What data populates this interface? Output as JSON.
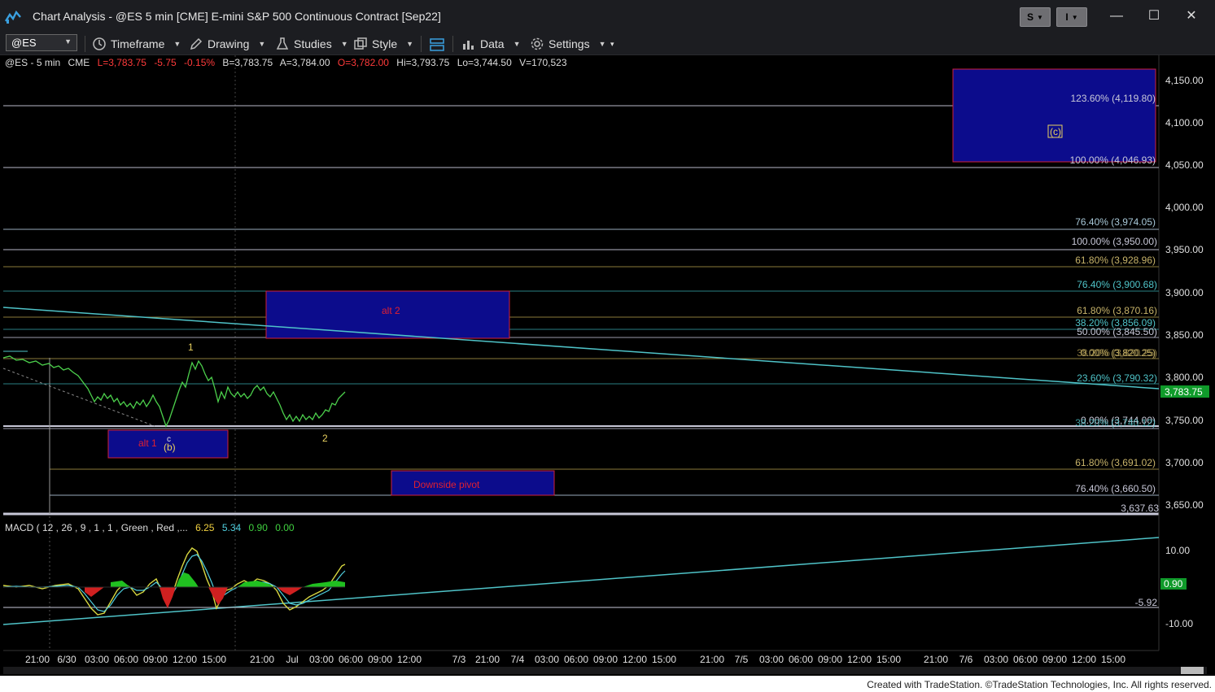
{
  "window": {
    "title": "Chart Analysis - @ES 5 min [CME] E-mini S&P 500 Continuous Contract [Sep22]",
    "ws_btn_s": "S",
    "ws_btn_i": "I",
    "min_glyph": "—",
    "max_glyph": "☐",
    "close_glyph": "✕"
  },
  "toolbar": {
    "symbol": "@ES",
    "timeframe": "Timeframe",
    "drawing": "Drawing",
    "studies": "Studies",
    "style": "Style",
    "data": "Data",
    "settings": "Settings"
  },
  "status": {
    "symbol": "@ES - 5 min",
    "exchange": "CME",
    "last": "L=3,783.75",
    "change": "-5.75",
    "pct": "-0.15%",
    "bid": "B=3,783.75",
    "ask": "A=3,784.00",
    "open": "O=3,782.00",
    "high": "Hi=3,793.75",
    "low": "Lo=3,744.50",
    "volume": "V=170,523"
  },
  "macd_status": {
    "label": "MACD ( 12 , 26 , 9 , 1 , 1 , Green , Red ,...",
    "macd": "6.25",
    "signal": "5.34",
    "hist": "0.90",
    "zero": "0.00"
  },
  "price_axis": [
    "4,150.00",
    "4,100.00",
    "4,050.00",
    "4,000.00",
    "3,950.00",
    "3,900.00",
    "3,850.00",
    "3,800.00",
    "3,750.00",
    "3,700.00",
    "3,650.00"
  ],
  "last_price_tag": "3,783.75",
  "macd_axis": [
    "10.00",
    "-10.00"
  ],
  "macd_tag": "0.90",
  "macd_level_label": "-5.92",
  "time_axis": [
    "21:00",
    "6/30",
    "03:00",
    "06:00",
    "09:00",
    "12:00",
    "15:00",
    "21:00",
    "Jul",
    "03:00",
    "06:00",
    "09:00",
    "12:00",
    "7/3",
    "21:00",
    "7/4",
    "03:00",
    "06:00",
    "09:00",
    "12:00",
    "15:00",
    "21:00",
    "7/5",
    "03:00",
    "06:00",
    "09:00",
    "12:00",
    "15:00",
    "21:00",
    "7/6",
    "03:00",
    "06:00",
    "09:00",
    "12:00",
    "15:00"
  ],
  "fib_labels": {
    "f1236": "123.60% (4,119.80)",
    "f1000top": "100.00% (4,046.93)",
    "f764a": "76.40% (3,974.05)",
    "f1000b": "100.00% (3,950.00)",
    "f618a": "61.80% (3,928.96)",
    "f764b": "76.40% (3,900.68)",
    "f618b": "61.80% (3,870.16)",
    "f382": "38.20% (3,856.09)",
    "f500": "50.00% (3,845.50)",
    "f000a": "0.00% (3,820.25)",
    "f382b": "38.20% (3,820.25)",
    "f236": "23.60% (3,790.32)",
    "f000b": "0.00% (3,744.00)",
    "f382c": "38.20% (3,740.12)",
    "f618c": "61.80% (3,691.02)",
    "f764c": "76.40% (3,660.50)",
    "low_level": "3,637.63"
  },
  "annotations": {
    "wave_c_box": "(c)",
    "alt2": "alt 2",
    "alt1": "alt 1",
    "wave_b": "(b)",
    "wave_c_small": "c",
    "wave_1": "1",
    "wave_2": "2",
    "downside": "Downside pivot"
  },
  "footer": "Created with TradeStation. ©TradeStation Technologies, Inc. All rights reserved.",
  "colors": {
    "price_line": "#4cd04c",
    "trendline": "#4fc3c8",
    "box_fill": "#0c0c8c",
    "box_border": "#d0203a",
    "fib_gold": "#c8b46a",
    "fib_teal": "#6cc3c8",
    "fib_white": "#c8c8d8"
  }
}
